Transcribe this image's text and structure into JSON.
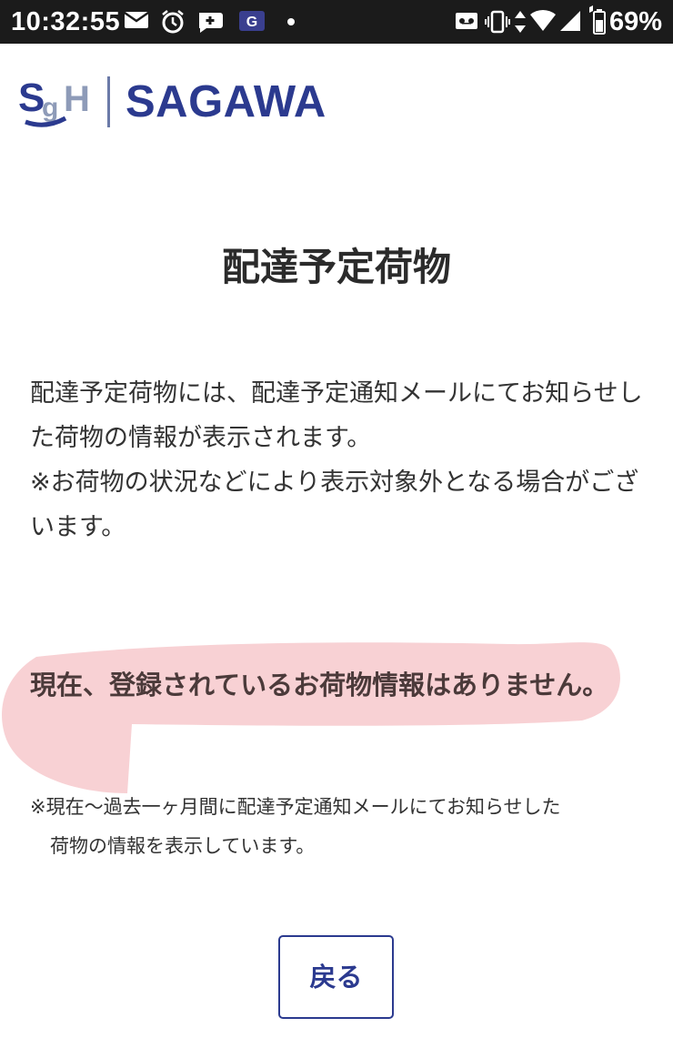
{
  "status_bar": {
    "time": "10:32:55",
    "battery_percent": "69%",
    "icons": [
      "mail-icon",
      "alarm-clock-icon",
      "chat-plus-icon",
      "app-g-icon",
      "dot-icon",
      "voicemail-icon",
      "vibrate-icon",
      "data-arrows-icon",
      "wifi-icon",
      "signal-icon",
      "battery-icon"
    ]
  },
  "logo": {
    "mark": "SgH",
    "wordmark": "SAGAWA",
    "color": "#2b3a8f"
  },
  "page": {
    "title": "配達予定荷物",
    "description_line1": "配達予定荷物には、配達予定通知メールにてお知らせした荷物の情報が表示されます。",
    "description_line2": "※お荷物の状況などにより表示対象外となる場合がございます。",
    "notice": "現在、登録されているお荷物情報はありません。",
    "footnote_line1": "※現在〜過去一ヶ月間に配達予定通知メールにてお知らせした",
    "footnote_line2": "荷物の情報を表示しています。",
    "highlight_color": "#f7c9cc"
  },
  "actions": {
    "back_label": "戻る"
  }
}
